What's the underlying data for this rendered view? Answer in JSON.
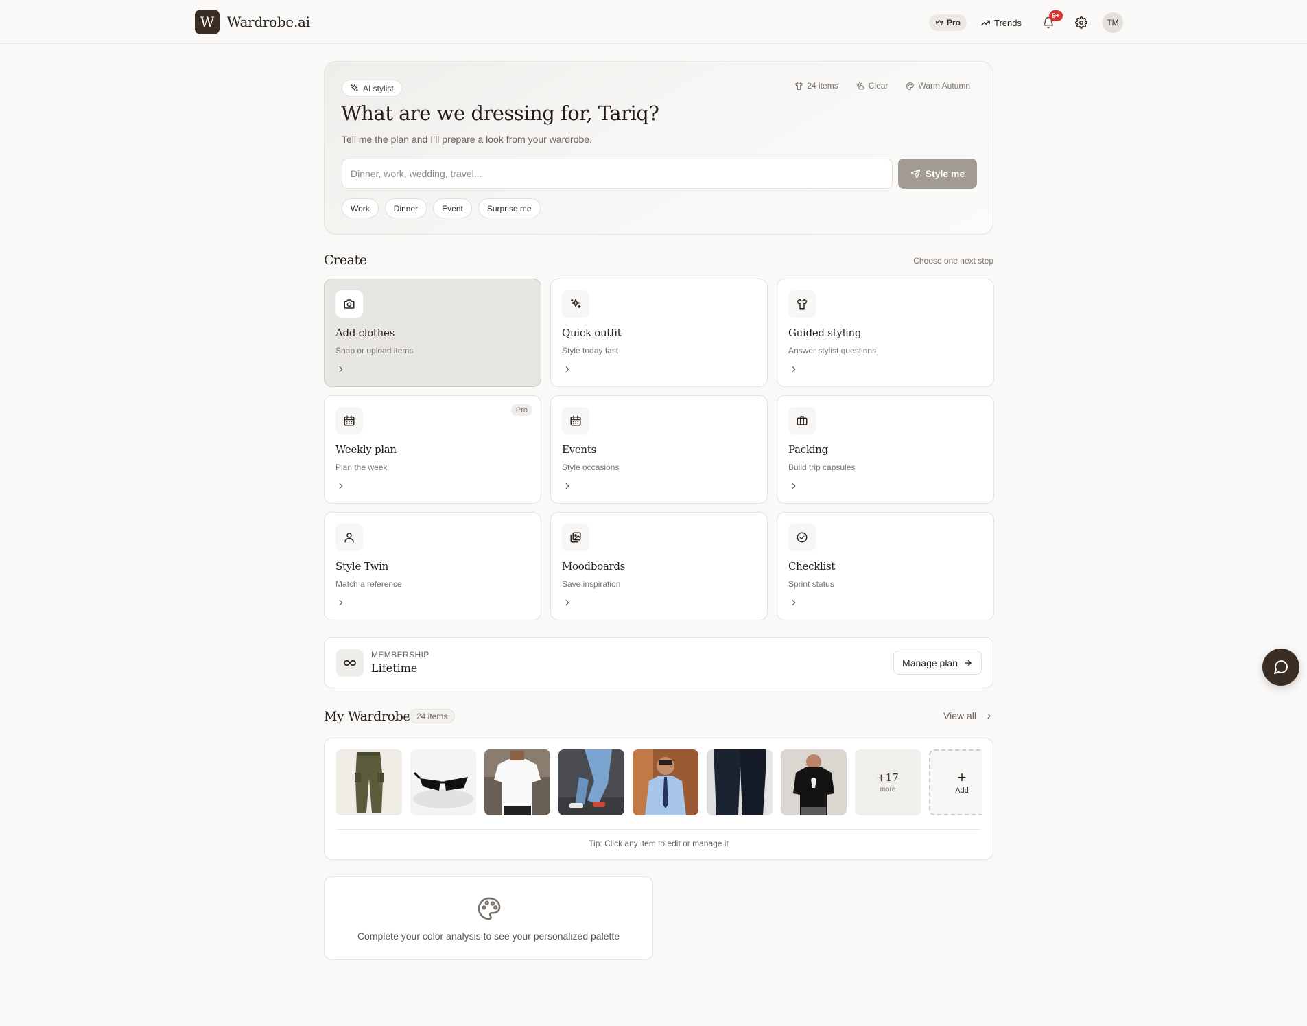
{
  "app": {
    "logo_letter": "W",
    "name": "Wardrobe.ai"
  },
  "header": {
    "pro_label": "Pro",
    "trends_label": "Trends",
    "notifications_badge": "9+",
    "avatar_initials": "TM"
  },
  "hero": {
    "chip_label": "AI stylist",
    "meta": {
      "items": "24 items",
      "weather": "Clear",
      "season": "Warm Autumn"
    },
    "title": "What are we dressing for, Tariq?",
    "subtitle": "Tell me the plan and I’ll prepare a look from your wardrobe.",
    "input_placeholder": "Dinner, work, wedding, travel...",
    "input_value": "",
    "submit_label": "Style me",
    "quick_chips": [
      "Work",
      "Dinner",
      "Event",
      "Surprise me"
    ]
  },
  "create": {
    "title": "Create",
    "hint": "Choose one next step",
    "tiles": [
      {
        "icon": "camera-icon",
        "title": "Add clothes",
        "subtitle": "Snap or upload items",
        "badge": ""
      },
      {
        "icon": "sparkles-icon",
        "title": "Quick outfit",
        "subtitle": "Style today fast",
        "badge": ""
      },
      {
        "icon": "shirt-icon",
        "title": "Guided styling",
        "subtitle": "Answer stylist questions",
        "badge": ""
      },
      {
        "icon": "calendar-icon",
        "title": "Weekly plan",
        "subtitle": "Plan the week",
        "badge": "Pro"
      },
      {
        "icon": "calendar-icon",
        "title": "Events",
        "subtitle": "Style occasions",
        "badge": ""
      },
      {
        "icon": "briefcase-icon",
        "title": "Packing",
        "subtitle": "Build trip capsules",
        "badge": ""
      },
      {
        "icon": "user-icon",
        "title": "Style Twin",
        "subtitle": "Match a reference",
        "badge": ""
      },
      {
        "icon": "images-icon",
        "title": "Moodboards",
        "subtitle": "Save inspiration",
        "badge": ""
      },
      {
        "icon": "check-circle-icon",
        "title": "Checklist",
        "subtitle": "Sprint status",
        "badge": ""
      }
    ]
  },
  "membership": {
    "icon": "infinity-icon",
    "label": "MEMBERSHIP",
    "value": "Lifetime",
    "button_label": "Manage plan"
  },
  "wardrobe": {
    "title": "My Wardrobe",
    "count": "24 items",
    "view_all": "View all",
    "items": [
      "olive-cargo-pants-photo",
      "black-sunglasses-photo",
      "white-tshirt-photo",
      "blue-jeans-outfit-photo",
      "blue-shirt-man-photo",
      "dark-denim-jeans-photo",
      "black-graphic-tee-photo"
    ],
    "more_count": "+17",
    "more_label": "more",
    "add_label": "Add",
    "tip": "Tip: Click any item to edit or manage it"
  },
  "palette": {
    "icon": "palette-icon",
    "message": "Complete your color analysis to see your personalized palette"
  },
  "colors": {
    "brand": "#3a2d23",
    "badge": "#d8322e",
    "active_tile": "#e8e6e2",
    "submit_button": "#a29b94"
  }
}
